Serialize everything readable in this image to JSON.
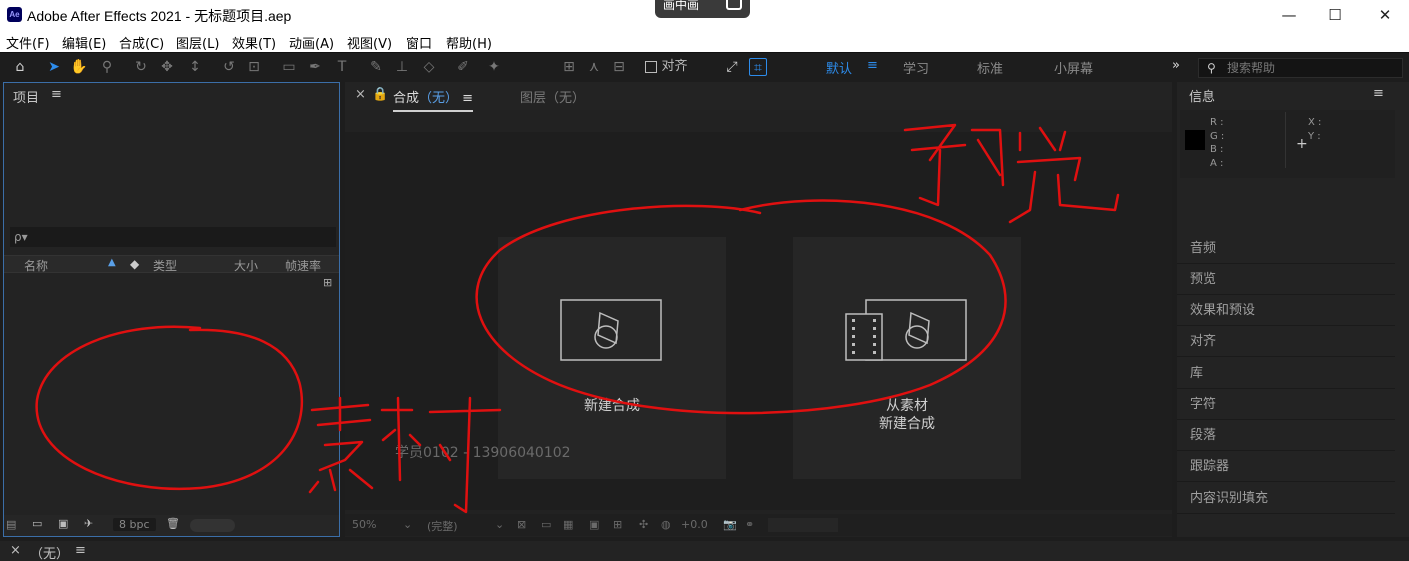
{
  "window": {
    "title": "Adobe After Effects 2021 - 无标题项目.aep",
    "app_icon": "Ae",
    "pip_label": "画中画",
    "controls": {
      "minimize": "—",
      "maximize": "☐",
      "close": "✕"
    }
  },
  "menu": [
    "文件(F)",
    "编辑(E)",
    "合成(C)",
    "图层(L)",
    "效果(T)",
    "动画(A)",
    "视图(V)",
    "窗口",
    "帮助(H)"
  ],
  "toolbar": {
    "align_label": "对齐",
    "workspaces": [
      "默认",
      "学习",
      "标准",
      "小屏幕"
    ],
    "active_workspace": "默认",
    "more_icon": "»",
    "search_placeholder": "搜索帮助"
  },
  "project_panel": {
    "title": "项目",
    "menu_icon": "≡",
    "search_icon": "ρ▾",
    "columns": [
      "名称",
      "类型",
      "大小",
      "帧速率"
    ],
    "bpc": "8 bpc"
  },
  "composition_panel": {
    "tab_comp": "合成",
    "tab_comp_value": "（无）",
    "tab_layer": "图层（无）",
    "card_new_comp": "新建合成",
    "card_from_footage_line1": "从素材",
    "card_from_footage_line2": "新建合成",
    "watermark": "学员0102 - 13906040102",
    "footer": {
      "zoom": "50%",
      "resolution": "(完整)",
      "exposure": "+0.0"
    }
  },
  "info_panel": {
    "title": "信息",
    "rgba_labels": [
      "R :",
      "G :",
      "B :",
      "A :"
    ],
    "xy_labels": [
      "X :",
      "Y :"
    ],
    "swatch_color": "#000000"
  },
  "right_panels": [
    "音频",
    "预览",
    "效果和预设",
    "对齐",
    "库",
    "字符",
    "段落",
    "跟踪器",
    "内容识别填充"
  ],
  "timeline": {
    "close_icon": "×",
    "label": "（无）",
    "menu_icon": "≡"
  },
  "annotations": {
    "ink_color": "#e01010",
    "handwritten_preview": "预览",
    "handwritten_footage": "素材"
  },
  "colors": {
    "accent": "#2d8ceb",
    "panel_bg": "#232323",
    "app_bg": "#1d1d1d"
  }
}
